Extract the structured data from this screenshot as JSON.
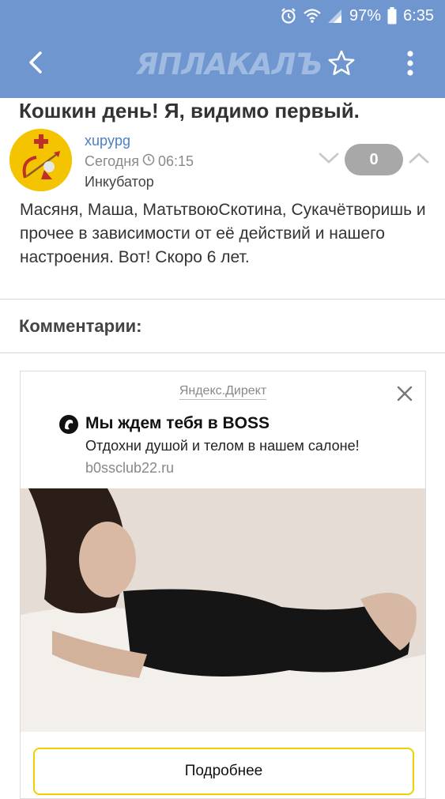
{
  "status_bar": {
    "battery": "97%",
    "time": "6:35",
    "icons": [
      "alarm-icon",
      "wifi-icon",
      "signal-icon",
      "battery-icon"
    ]
  },
  "app_bar": {
    "logo_text": "ЯПЛАКАЛЪ",
    "icons": [
      "back-arrow-icon",
      "star-icon",
      "more-vert-icon"
    ]
  },
  "post": {
    "title": "Кошкин день! Я, видимо первый.",
    "author": "xupypg",
    "time_prefix": "Сегодня",
    "time": "06:15",
    "category": "Инкубатор",
    "rating": "0",
    "text": "Масяня, Маша, МатьтвоюСкотина, Сукачётворишь и прочее в зависимости от её действий и нашего настроения. Вот! Скоро 6 лет."
  },
  "comments": {
    "heading": "Комментарии:"
  },
  "ad": {
    "source": "Яндекс.Директ",
    "title": "Мы ждем тебя в BOSS",
    "description": "Отдохни душой и телом в нашем салоне!",
    "domain": "b0ssclub22.ru",
    "button_label": "Подробнее"
  },
  "colors": {
    "top_bar": "#6f96cf",
    "author_link": "#4a7fc2",
    "vote_badge": "#a8a8a8",
    "ad_button_border": "#f0d000"
  }
}
